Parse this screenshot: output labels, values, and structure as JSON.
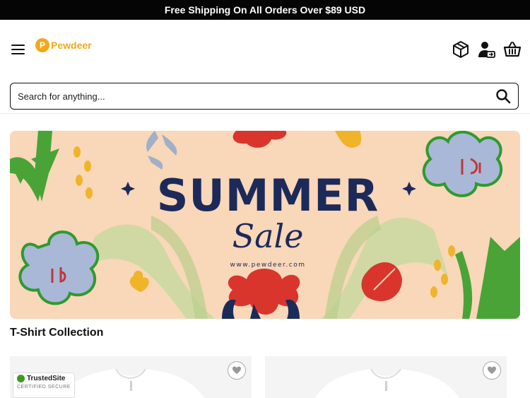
{
  "announcement": "Free Shipping On All Orders Over $89 USD",
  "header": {
    "logo_mark": "P",
    "logo_text": "Pewdeer"
  },
  "search": {
    "placeholder": "Search for anything..."
  },
  "banner": {
    "title": "SUMMER",
    "subtitle": "Sale",
    "url": "www.pewdeer.com"
  },
  "collection": {
    "title": "T-Shirt Collection"
  },
  "trust_badge": {
    "name": "TrustedSite",
    "caption": "CERTIFIED SECURE"
  },
  "colors": {
    "brand": "#f3a81c",
    "banner_bg": "#f9d7b9",
    "banner_title": "#1c2a5a",
    "topbar_bg": "#050505"
  }
}
